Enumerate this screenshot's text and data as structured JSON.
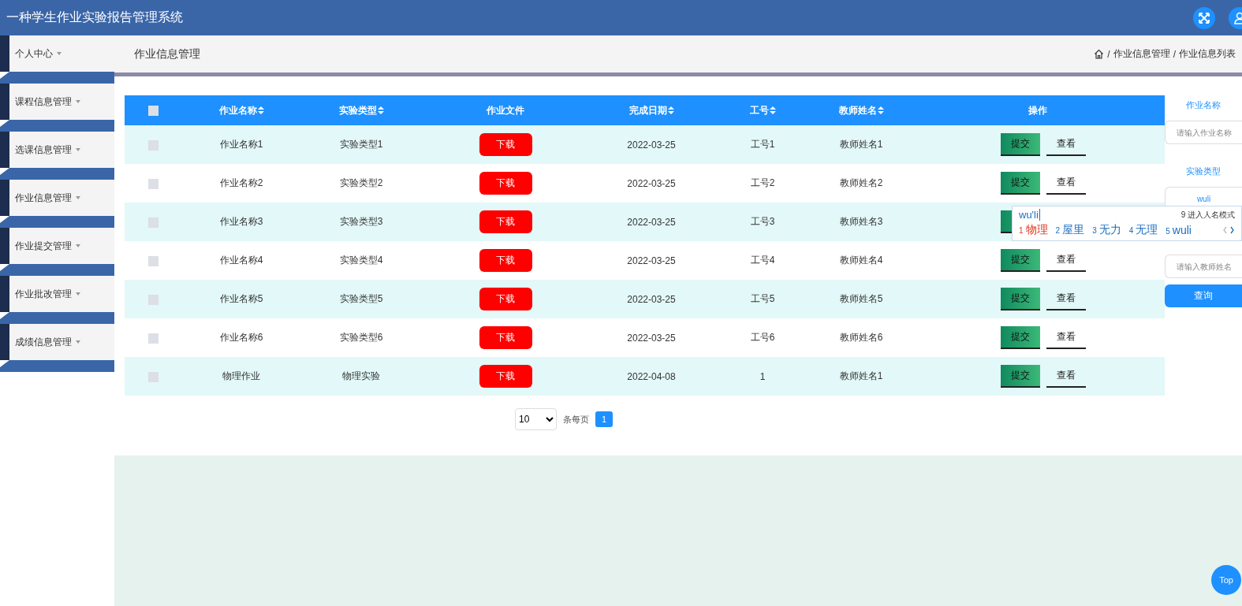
{
  "header": {
    "title": "一种学生作业实验报告管理系统"
  },
  "sidebar": {
    "items": [
      {
        "label": "个人中心"
      },
      {
        "label": "课程信息管理"
      },
      {
        "label": "选课信息管理"
      },
      {
        "label": "作业信息管理"
      },
      {
        "label": "作业提交管理"
      },
      {
        "label": "作业批改管理"
      },
      {
        "label": "成绩信息管理"
      }
    ]
  },
  "breadcrumb": {
    "page_title": "作业信息管理",
    "path": [
      {
        "separator": "/",
        "label": "作业信息管理"
      },
      {
        "separator": "/",
        "label": "作业信息列表"
      }
    ]
  },
  "table": {
    "header_checked": false,
    "columns": [
      {
        "label": "作业名称",
        "sortable": true
      },
      {
        "label": "实验类型",
        "sortable": true
      },
      {
        "label": "作业文件",
        "sortable": false
      },
      {
        "label": "完成日期",
        "sortable": true
      },
      {
        "label": "工号",
        "sortable": true
      },
      {
        "label": "教师姓名",
        "sortable": true
      },
      {
        "label": "操作",
        "sortable": false
      }
    ],
    "rows": [
      {
        "checked": false,
        "name": "作业名称1",
        "type": "实验类型1",
        "file": "下载",
        "date": "2022-03-25",
        "id": "工号1",
        "teacher": "教师姓名1",
        "actions": [
          {
            "kind": "submit",
            "label": "提交"
          },
          {
            "kind": "view",
            "label": "查看"
          }
        ]
      },
      {
        "checked": false,
        "name": "作业名称2",
        "type": "实验类型2",
        "file": "下载",
        "date": "2022-03-25",
        "id": "工号2",
        "teacher": "教师姓名2",
        "actions": [
          {
            "kind": "submit",
            "label": "提交"
          },
          {
            "kind": "view",
            "label": "查看"
          }
        ]
      },
      {
        "checked": false,
        "name": "作业名称3",
        "type": "实验类型3",
        "file": "下载",
        "date": "2022-03-25",
        "id": "工号3",
        "teacher": "教师姓名3",
        "actions": [
          {
            "kind": "submit"
          }
        ]
      },
      {
        "checked": false,
        "name": "作业名称4",
        "type": "实验类型4",
        "file": "下载",
        "date": "2022-03-25",
        "id": "工号4",
        "teacher": "教师姓名4",
        "actions": [
          {
            "kind": "submit",
            "label": "提交"
          },
          {
            "kind": "view",
            "label": "查看"
          }
        ]
      },
      {
        "checked": false,
        "name": "作业名称5",
        "type": "实验类型5",
        "file": "下载",
        "date": "2022-03-25",
        "id": "工号5",
        "teacher": "教师姓名5",
        "actions": [
          {
            "kind": "submit",
            "label": "提交"
          },
          {
            "kind": "view",
            "label": "查看"
          }
        ]
      },
      {
        "checked": false,
        "name": "作业名称6",
        "type": "实验类型6",
        "file": "下载",
        "date": "2022-03-25",
        "id": "工号6",
        "teacher": "教师姓名6",
        "actions": [
          {
            "kind": "submit",
            "label": "提交"
          },
          {
            "kind": "view",
            "label": "查看"
          }
        ]
      },
      {
        "checked": false,
        "name": "物理作业",
        "type": "物理实验",
        "file": "下载",
        "date": "2022-04-08",
        "id": "1",
        "teacher": "教师姓名1",
        "actions": [
          {
            "kind": "submit",
            "label": "提交"
          },
          {
            "kind": "view",
            "label": "查看"
          }
        ]
      }
    ]
  },
  "pagination": {
    "page_size": "10",
    "per_page_label": "条每页",
    "pages": [
      {
        "label": "1",
        "selected": true
      }
    ]
  },
  "search": {
    "fields": [
      {
        "label": "作业名称",
        "placeholder": "请输入作业名称"
      },
      {
        "label": "实验类型",
        "value": "wuli"
      },
      {
        "placeholder": "请输入教师姓名"
      }
    ],
    "button": "查询"
  },
  "ime": {
    "composition": "wu'li",
    "mode_hint": "9 进入人名模式",
    "candidates": [
      {
        "number": "1",
        "text": "物理",
        "selected": true
      },
      {
        "number": "2",
        "text": "屋里",
        "selected": false
      },
      {
        "number": "3",
        "text": "无力",
        "selected": false
      },
      {
        "number": "4",
        "text": "无理",
        "selected": false
      },
      {
        "number": "5",
        "text": "wuli",
        "selected": false
      }
    ]
  },
  "back_to_top": "Top"
}
